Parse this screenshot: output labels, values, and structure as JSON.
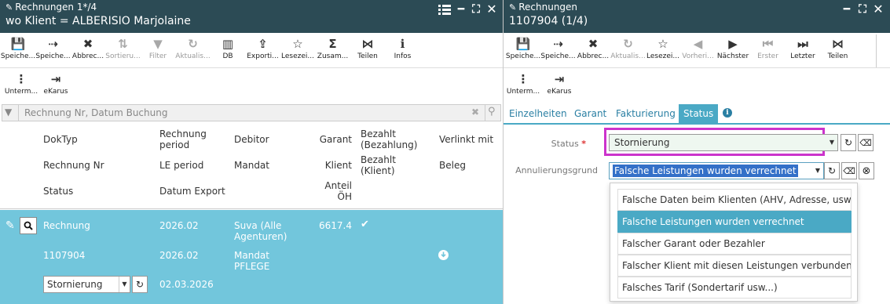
{
  "left": {
    "title": "Rechnungen 1*/4",
    "subtitle": "wo Klient = ALBERISIO Marjolaine",
    "toolbar": [
      {
        "icon": "save-icon",
        "label": "Speiche..."
      },
      {
        "icon": "save-next-icon",
        "label": "Speiche..."
      },
      {
        "icon": "cancel-icon",
        "label": "Abbrec..."
      },
      {
        "icon": "sort-icon",
        "label": "Sortieru..."
      },
      {
        "icon": "filter-icon",
        "label": "Filter"
      },
      {
        "icon": "refresh-icon",
        "label": "Aktualis..."
      },
      {
        "icon": "chart-icon",
        "label": "DB"
      },
      {
        "icon": "export-icon",
        "label": "Exporti..."
      },
      {
        "icon": "star-icon",
        "label": "Lesezei..."
      },
      {
        "icon": "sum-icon",
        "label": "Zusam..."
      },
      {
        "icon": "share-icon",
        "label": "Teilen"
      },
      {
        "icon": "info-icon",
        "label": "Infos"
      }
    ],
    "toolbar2": [
      {
        "icon": "more-icon",
        "label": "Unterm..."
      },
      {
        "icon": "ekarus-icon",
        "label": "eKarus"
      }
    ],
    "search_placeholder": "Rechnung Nr, Datum Buchung",
    "headers": {
      "doktyp": "DokTyp",
      "rechnung_period": "Rechnung period",
      "debitor": "Debitor",
      "garant": "Garant",
      "bezahlt": "Bezahlt (Bezahlung)",
      "verlinkt": "Verlinkt mit",
      "rechnung_nr": "Rechnung Nr",
      "le_period": "LE period",
      "mandat": "Mandat",
      "klient": "Klient",
      "bezahlt_klient": "Bezahlt (Klient)",
      "beleg": "Beleg",
      "status": "Status",
      "datum_export": "Datum Export",
      "anteil_oh": "Anteil ÖH"
    },
    "row": {
      "doktyp": "Rechnung",
      "rechnung_period": "2026.02",
      "debitor": "Suva (Alle Agenturen)",
      "garant": "6617.4",
      "rechnung_nr": "1107904",
      "le_period": "2026.02",
      "mandat": "Mandat PFLEGE",
      "status": "Stornierung",
      "datum_export": "02.03.2026"
    }
  },
  "right": {
    "title": "Rechnungen",
    "subtitle": "1107904 (1/4)",
    "toolbar": [
      {
        "icon": "save-icon",
        "label": "Speiche..."
      },
      {
        "icon": "save-next-icon",
        "label": "Speiche..."
      },
      {
        "icon": "cancel-icon",
        "label": "Abbrec..."
      },
      {
        "icon": "refresh-icon",
        "label": "Aktualis..."
      },
      {
        "icon": "star-icon",
        "label": "Lesezei..."
      },
      {
        "icon": "previous-icon",
        "label": "Vorheri..."
      },
      {
        "icon": "next-icon",
        "label": "Nächster"
      },
      {
        "icon": "first-icon",
        "label": "Erster"
      },
      {
        "icon": "last-icon",
        "label": "Letzter"
      },
      {
        "icon": "share-icon",
        "label": "Teilen"
      }
    ],
    "toolbar2": [
      {
        "icon": "more-icon",
        "label": "Unterm..."
      },
      {
        "icon": "ekarus-icon",
        "label": "eKarus"
      }
    ],
    "tabs": [
      "Einzelheiten",
      "Garant",
      "Fakturierung",
      "Status"
    ],
    "active_tab": "Status",
    "status_label": "Status",
    "required_mark": "*",
    "status_value": "Stornierung",
    "grund_label": "Annulierungsgrund",
    "grund_value": "Falsche Leistungen wurden verrechnet",
    "options": [
      "Falsche Daten beim Klienten (AHV, Adresse, usw...)",
      "Falsche Leistungen wurden verrechnet",
      "Falscher Garant oder Bezahler",
      "Falscher Klient mit diesen Leistungen verbunden",
      "Falsches Tarif (Sondertarif usw...)"
    ],
    "selected_option": "Falsche Leistungen wurden verrechnet"
  },
  "colors": {
    "titlebar": "#2c4b55",
    "selected_row": "#72c6dc",
    "active_tab": "#4aa9c5",
    "highlight_border": "#cc33cc",
    "link": "#2a7fa3"
  }
}
